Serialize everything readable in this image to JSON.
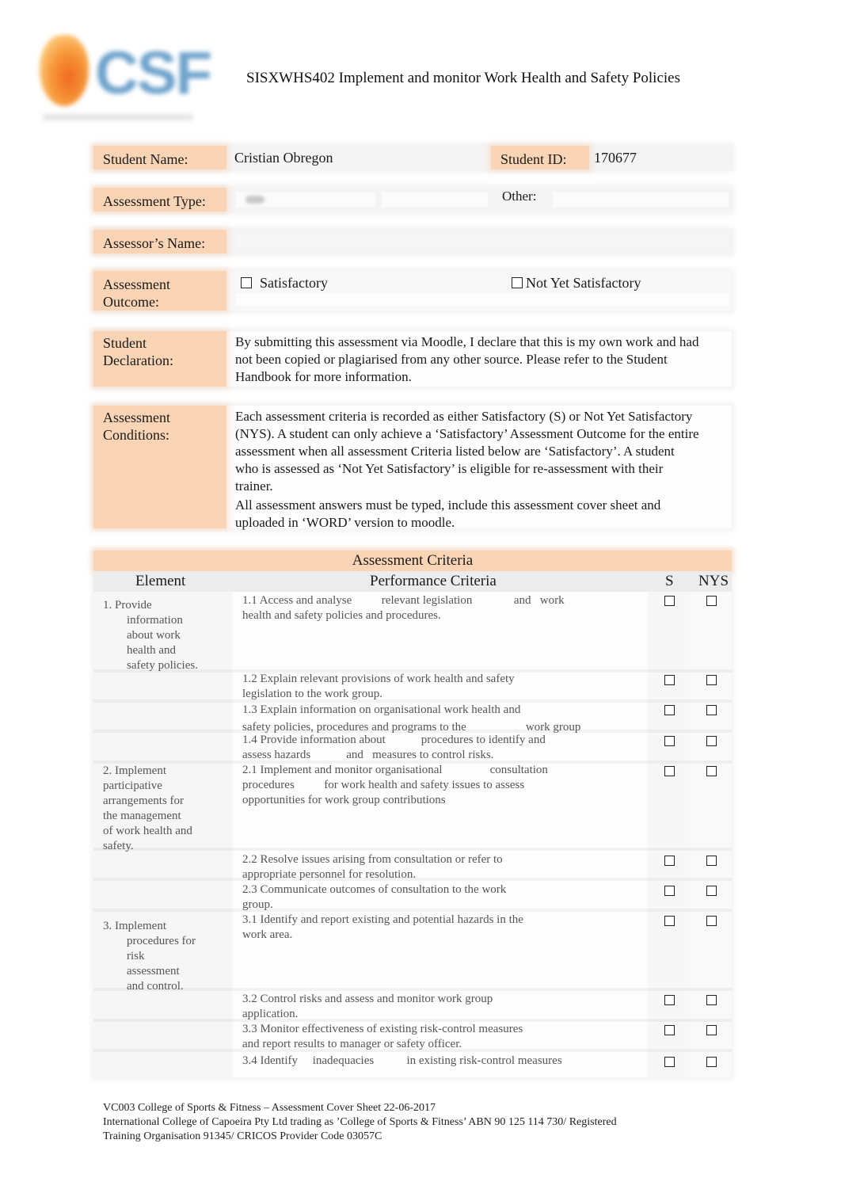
{
  "header": {
    "logo_text": "CSF",
    "title": "SISXWHS402 Implement and monitor Work Health and Safety Policies"
  },
  "cover_sheet": {
    "student_name_label": "Student Name:",
    "student_name_value": "Cristian Obregon",
    "student_id_label": "Student ID:",
    "student_id_value": "170677",
    "assessment_type_label": "Assessment Type:",
    "assessment_type_value": "",
    "other_label": "Other:",
    "other_value": "",
    "assessor_name_label": "Assessor’s Name:",
    "assessor_name_value": "",
    "outcome_label_1": "Assessment",
    "outcome_label_2": "Outcome:",
    "outcome_options": [
      {
        "label": "Satisfactory",
        "checked": false
      },
      {
        "label": "Not Yet Satisfactory",
        "checked": false
      }
    ],
    "declaration_label_1": "Student",
    "declaration_label_2": "Declaration:",
    "declaration_lines": [
      "By submitting this assessment via Moodle, I declare that this is my own work and had",
      "not been copied or plagiarised from any other source. Please refer to the Student",
      "Handbook for more information."
    ],
    "conditions_label_1": "Assessment",
    "conditions_label_2": "Conditions:",
    "conditions_lines": [
      "Each assessment criteria is recorded as either Satisfactory (S) or Not Yet Satisfactory",
      "(NYS). A student can only achieve a ‘Satisfactory’ Assessment Outcome for the entire",
      "assessment when all assessment Criteria listed below are ‘Satisfactory’. A student",
      "who is assessed as ‘Not Yet Satisfactory’ is eligible for re-assessment with their",
      "trainer.",
      "All assessment answers must be typed, include this assessment cover sheet and",
      "uploaded in ‘WORD’ version to moodle."
    ]
  },
  "criteria": {
    "title": "Assessment Criteria",
    "headers": {
      "element": "Element",
      "performance": "Performance Criteria",
      "s": "S",
      "nys": "NYS"
    },
    "elements": [
      {
        "first": "1. Provide",
        "rest": [
          "information",
          "about work",
          "health and",
          "safety policies."
        ]
      },
      {
        "first": "2. Implement",
        "rest_flush": [
          "participative",
          "arrangements for",
          "the management",
          "of work health and",
          "safety."
        ]
      },
      {
        "first": "3. Implement",
        "rest": [
          "procedures for",
          "risk",
          "assessment",
          "and control."
        ]
      }
    ],
    "performance": [
      {
        "line1": "1.1 Access and analyse          relevant legislation              and   work",
        "line2": "health and safety policies and procedures.",
        "s": false,
        "nys": false
      },
      {
        "line1": "1.2 Explain relevant provisions of work health and safety",
        "line2": "legislation to the work group.",
        "s": false,
        "nys": false
      },
      {
        "line1": "1.3 Explain information on organisational work health and",
        "line2": "safety policies, procedures and programs to the                    work group",
        "s": false,
        "nys": false
      },
      {
        "line1": "1.4 Provide information about            procedures to identify and",
        "line2": "assess hazards            and   measures to control risks.",
        "s": false,
        "nys": false
      },
      {
        "line1": "2.1 Implement and monitor organisational                consultation",
        "line2": "procedures          for work health and safety issues to assess",
        "line3": "opportunities for work group contributions",
        "s": false,
        "nys": false
      },
      {
        "line1": "2.2 Resolve issues arising from consultation or refer to",
        "line2": "appropriate personnel for resolution.",
        "s": false,
        "nys": false
      },
      {
        "line1": "2.3 Communicate outcomes of consultation to the work",
        "line2": "group.",
        "s": false,
        "nys": false
      },
      {
        "line1": "3.1 Identify and report existing and potential hazards in the",
        "line2": "work area.",
        "s": false,
        "nys": false
      },
      {
        "line1": "3.2 Control risks and assess and monitor work group",
        "line2": "application.",
        "s": false,
        "nys": false
      },
      {
        "line1": "3.3 Monitor effectiveness of existing risk-control measures",
        "line2": "and report results to manager or safety officer.",
        "s": false,
        "nys": false
      },
      {
        "line1": "3.4 Identify     inadequacies           in existing risk-control measures",
        "line2": "",
        "s": false,
        "nys": false
      }
    ]
  },
  "footer": {
    "line1": "VC003 College of Sports & Fitness – Assessment Cover Sheet 22-06-2017",
    "line2": "International College of Capoeira Pty Ltd trading as ’College of Sports & Fitness’ ABN 90 125 114 730/ Registered",
    "line3": "Training Organisation 91345/ CRICOS Provider Code 03057C"
  }
}
